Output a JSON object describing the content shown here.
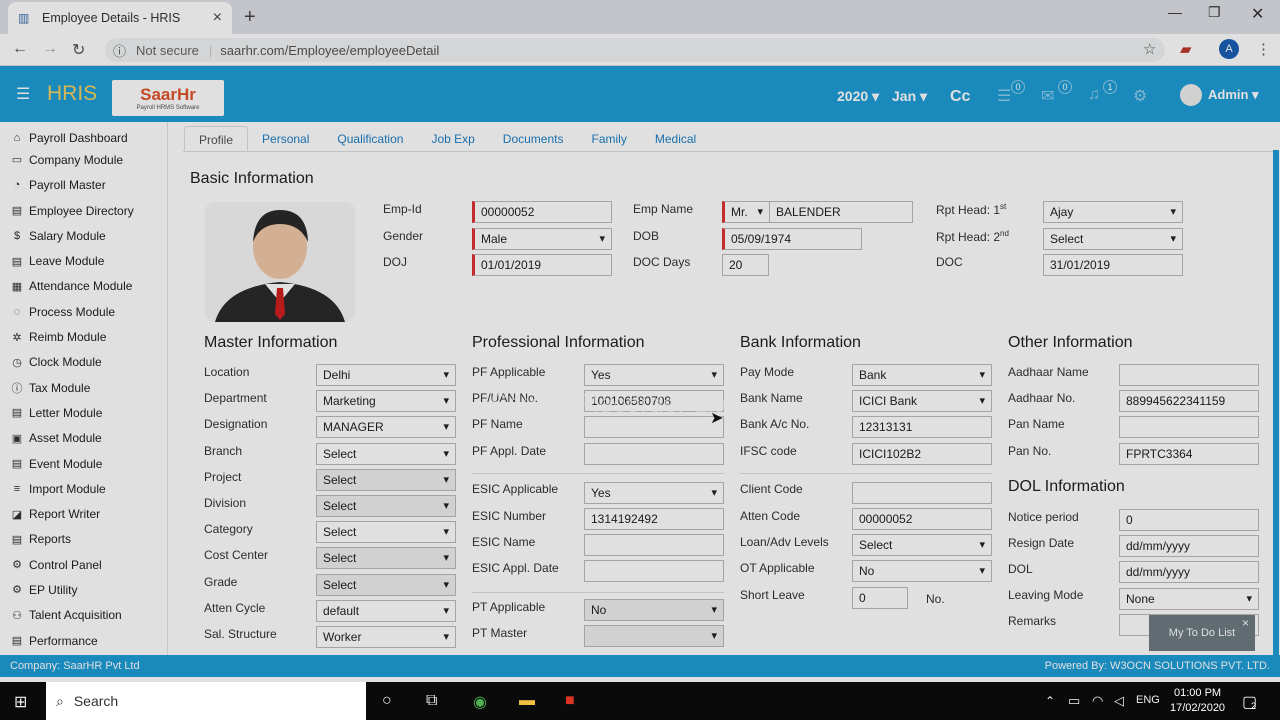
{
  "browser": {
    "tab_title": "Employee Details - HRIS",
    "not_secure": "Not secure",
    "url": "saarhr.com/Employee/employeeDetail",
    "profile_initial": "A"
  },
  "header": {
    "brand": "HRIS",
    "logo_text": "SaarHr",
    "logo_sub": "Payroll HRMS Software",
    "year": "2020 ▾",
    "month": "Jan ▾",
    "currency": "Cc",
    "badge1": "0",
    "badge2": "0",
    "badge3": "1",
    "user": "Admin ▾"
  },
  "sidebar": {
    "items": [
      {
        "icon": "⌂",
        "label": "Payroll Dashboard"
      },
      {
        "icon": "▭",
        "label": "Company Module"
      },
      {
        "icon": "◔",
        "label": "Payroll Master"
      },
      {
        "icon": "▤",
        "label": "Employee Directory"
      },
      {
        "icon": "$",
        "label": "Salary Module"
      },
      {
        "icon": "▤",
        "label": "Leave Module"
      },
      {
        "icon": "▦",
        "label": "Attendance Module"
      },
      {
        "icon": "◌",
        "label": "Process Module"
      },
      {
        "icon": "✲",
        "label": "Reimb Module"
      },
      {
        "icon": "◷",
        "label": "Clock Module"
      },
      {
        "icon": "ⓘ",
        "label": "Tax Module"
      },
      {
        "icon": "▤",
        "label": "Letter Module"
      },
      {
        "icon": "▣",
        "label": "Asset Module"
      },
      {
        "icon": "▤",
        "label": "Event Module"
      },
      {
        "icon": "≡",
        "label": "Import Module"
      },
      {
        "icon": "◪",
        "label": "Report Writer"
      },
      {
        "icon": "▤",
        "label": "Reports"
      },
      {
        "icon": "⚙",
        "label": "Control Panel"
      },
      {
        "icon": "⚙",
        "label": "EP Utility"
      },
      {
        "icon": "⚇",
        "label": "Talent Acquisition"
      },
      {
        "icon": "▤",
        "label": "Performance"
      }
    ]
  },
  "tabs": [
    "Profile",
    "Personal",
    "Qualification",
    "Job Exp",
    "Documents",
    "Family",
    "Medical"
  ],
  "basic": {
    "title": "Basic Information",
    "emp_id_label": "Emp-Id",
    "emp_id": "00000052",
    "gender_label": "Gender",
    "gender": "Male",
    "doj_label": "DOJ",
    "doj": "01/01/2019",
    "emp_name_label": "Emp Name",
    "salutation": "Mr.",
    "emp_name": "BALENDER",
    "dob_label": "DOB",
    "dob": "05/09/1974",
    "doc_days_label": "DOC Days",
    "doc_days": "20",
    "rpt1_label": "Rpt Head: 1",
    "rpt1_sup": "st",
    "rpt1": "Ajay Kumar_00000100",
    "rpt2_label": "Rpt Head: 2",
    "rpt2_sup": "nd",
    "rpt2": "Select",
    "doc_label": "DOC",
    "doc": "31/01/2019"
  },
  "master": {
    "title": "Master Information",
    "rows": [
      {
        "label": "Location",
        "value": "Delhi",
        "gray": false
      },
      {
        "label": "Department",
        "value": "Marketing",
        "gray": false
      },
      {
        "label": "Designation",
        "value": "MANAGER",
        "gray": false
      },
      {
        "label": "Branch",
        "value": "Select",
        "gray": false
      },
      {
        "label": "Project",
        "value": "Select",
        "gray": true
      },
      {
        "label": "Division",
        "value": "Select",
        "gray": true
      },
      {
        "label": "Category",
        "value": "Select",
        "gray": false
      },
      {
        "label": "Cost Center",
        "value": "Select",
        "gray": true
      },
      {
        "label": "Grade",
        "value": "Select",
        "gray": true
      },
      {
        "label": "Atten Cycle",
        "value": "default",
        "gray": false
      },
      {
        "label": "Sal. Structure",
        "value": "Worker",
        "gray": false
      }
    ]
  },
  "professional": {
    "title": "Professional Information",
    "pf_applicable_label": "PF Applicable",
    "pf_applicable": "Yes",
    "pf_uan_label": "PF/UAN No.",
    "pf_uan": "100106580708",
    "pf_name_label": "PF Name",
    "pf_name": "",
    "pf_date_label": "PF Appl. Date",
    "pf_date": "",
    "esic_applicable_label": "ESIC Applicable",
    "esic_applicable": "Yes",
    "esic_number_label": "ESIC Number",
    "esic_number": "1314192492",
    "esic_name_label": "ESIC Name",
    "esic_name": "",
    "esic_date_label": "ESIC Appl. Date",
    "esic_date": "",
    "pt_applicable_label": "PT Applicable",
    "pt_applicable": "No",
    "pt_master_label": "PT Master",
    "pt_master": ""
  },
  "bank": {
    "title": "Bank Information",
    "pay_mode_label": "Pay Mode",
    "pay_mode": "Bank",
    "bank_name_label": "Bank Name",
    "bank_name": "ICICI Bank",
    "account_label": "Bank A/c No.",
    "account": "12313131",
    "ifsc_label": "IFSC code",
    "ifsc": "ICICI102B2",
    "client_label": "Client Code",
    "client": "",
    "atten_code_label": "Atten Code",
    "atten_code": "00000052",
    "loan_label": "Loan/Adv Levels",
    "loan": "Select",
    "ot_label": "OT Applicable",
    "ot": "No",
    "short_leave_label": "Short Leave",
    "short_leave": "0",
    "short_leave_unit": "No."
  },
  "other": {
    "title": "Other Information",
    "aadhaar_name_label": "Aadhaar Name",
    "aadhaar_name": "",
    "aadhaar_no_label": "Aadhaar No.",
    "aadhaar_no": "889945622341159",
    "pan_name_label": "Pan Name",
    "pan_name": "",
    "pan_no_label": "Pan No.",
    "pan_no": "FPRTC3364"
  },
  "dol": {
    "title": "DOL Information",
    "notice_label": "Notice period",
    "notice": "0",
    "resign_label": "Resign Date",
    "resign": "dd/mm/yyyy",
    "dol_label": "DOL",
    "dol": "dd/mm/yyyy",
    "leaving_label": "Leaving Mode",
    "leaving": "None",
    "remarks_label": "Remarks"
  },
  "todo": {
    "label": "My To Do List",
    "close": "×"
  },
  "watermark": "Screen Recorder Lite",
  "footer": {
    "company": "Company: SaarHR Pvt Ltd",
    "powered": "Powered By: W3OCN SOLUTIONS PVT. LTD."
  },
  "taskbar": {
    "search": "Search",
    "lang": "ENG",
    "time": "01:00 PM",
    "date": "17/02/2020",
    "notif": "2"
  }
}
